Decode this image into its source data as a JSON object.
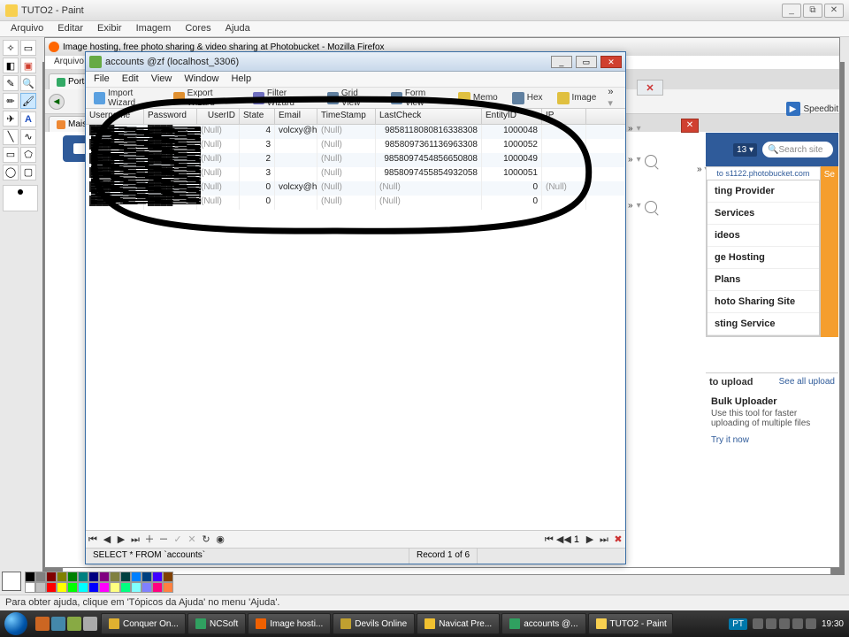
{
  "paint": {
    "title": "TUTO2 - Paint",
    "menu": [
      "Arquivo",
      "Editar",
      "Exibir",
      "Imagem",
      "Cores",
      "Ajuda"
    ],
    "status": "Para obter ajuda, clique em 'Tópicos da Ajuda' no menu 'Ajuda'."
  },
  "firefox": {
    "title": "Image hosting, free photo sharing & video sharing at Photobucket - Mozilla Firefox",
    "menu": [
      "Arquivo"
    ],
    "tabs": [
      {
        "label": "Ports"
      },
      {
        "label": "Mais"
      }
    ]
  },
  "speedbit": {
    "label": "Speedbit"
  },
  "navicat": {
    "title": "accounts @zf (localhost_3306)",
    "menu": [
      "File",
      "Edit",
      "View",
      "Window",
      "Help"
    ],
    "toolbar": [
      {
        "name": "import-wizard",
        "label": "Import Wizard",
        "color": "#5aa0e0"
      },
      {
        "name": "export-wizard",
        "label": "Export Wizard",
        "color": "#e09030"
      },
      {
        "name": "filter-wizard",
        "label": "Filter Wizard",
        "color": "#7070c0"
      },
      {
        "name": "grid-view",
        "label": "Grid View",
        "color": "#6080a0"
      },
      {
        "name": "form-view",
        "label": "Form View",
        "color": "#6080a0"
      },
      {
        "name": "memo",
        "label": "Memo",
        "color": "#e0c040"
      },
      {
        "name": "hex",
        "label": "Hex",
        "color": "#6080a0"
      },
      {
        "name": "image",
        "label": "Image",
        "color": "#e0c040"
      }
    ],
    "columns": [
      "Username",
      "Password",
      "UserID",
      "State",
      "Email",
      "TimeStamp",
      "LastCheck",
      "EntityID",
      "IP"
    ],
    "rows": [
      {
        "Username": "████",
        "Password": "████",
        "UserID": "(Null)",
        "State": "4",
        "Email": "volcxy@hx",
        "TimeStamp": "(Null)",
        "LastCheck": "9858118080816338308",
        "EntityID": "1000048",
        "IP": ""
      },
      {
        "Username": "████",
        "Password": "████",
        "UserID": "(Null)",
        "State": "3",
        "Email": "",
        "TimeStamp": "(Null)",
        "LastCheck": "9858097361136963308",
        "EntityID": "1000052",
        "IP": ""
      },
      {
        "Username": "████",
        "Password": "████",
        "UserID": "(Null)",
        "State": "2",
        "Email": "",
        "TimeStamp": "(Null)",
        "LastCheck": "9858097454856650808",
        "EntityID": "1000049",
        "IP": ""
      },
      {
        "Username": "████",
        "Password": "████",
        "UserID": "(Null)",
        "State": "3",
        "Email": "",
        "TimeStamp": "(Null)",
        "LastCheck": "9858097455854932058",
        "EntityID": "1000051",
        "IP": ""
      },
      {
        "Username": "████",
        "Password": "████",
        "UserID": "(Null)",
        "State": "0",
        "Email": "volcxy@hx",
        "TimeStamp": "(Null)",
        "LastCheck": "(Null)",
        "EntityID": "0",
        "IP": "(Null)"
      },
      {
        "Username": "████",
        "Password": "████",
        "UserID": "(Null)",
        "State": "0",
        "Email": "",
        "TimeStamp": "(Null)",
        "LastCheck": "(Null)",
        "EntityID": "0",
        "IP": ""
      }
    ],
    "sql": "SELECT * FROM `accounts`",
    "record": "Record 1 of 6",
    "recnum": "1"
  },
  "photobucket": {
    "searchPlaceholder": "Search site",
    "badge": "13",
    "sub": "to s1122.photobucket.com",
    "list": [
      "ting Provider",
      "Services",
      "ideos",
      "ge Hosting",
      "Plans",
      "hoto Sharing Site",
      "sting Service"
    ],
    "upload": {
      "heading": "to upload",
      "seeAll": "See all upload",
      "bulkTitle": "Bulk Uploader",
      "bulkDesc": "Use this tool for faster uploading of multiple files",
      "try": "Try it now"
    }
  },
  "taskbar": {
    "items": [
      {
        "label": "Conquer On...",
        "color": "#e0b030"
      },
      {
        "label": "NCSoft",
        "color": "#30a060"
      },
      {
        "label": "Image hosti...",
        "color": "#f06000"
      },
      {
        "label": "Devils Online",
        "color": "#c0a030"
      },
      {
        "label": "Navicat Pre...",
        "color": "#f0c030"
      },
      {
        "label": "accounts @...",
        "color": "#30a060"
      },
      {
        "label": "TUTO2 - Paint",
        "color": "#f8d050"
      }
    ],
    "lang": "PT",
    "time": "19:30"
  },
  "palette": [
    "#000",
    "#808080",
    "#800000",
    "#808000",
    "#008000",
    "#008080",
    "#000080",
    "#800080",
    "#808040",
    "#004040",
    "#0080ff",
    "#004080",
    "#4000ff",
    "#804000",
    "#fff",
    "#c0c0c0",
    "#f00",
    "#ff0",
    "#0f0",
    "#0ff",
    "#00f",
    "#f0f",
    "#ffff80",
    "#00ff80",
    "#80ffff",
    "#8080ff",
    "#ff0080",
    "#ff8040"
  ]
}
